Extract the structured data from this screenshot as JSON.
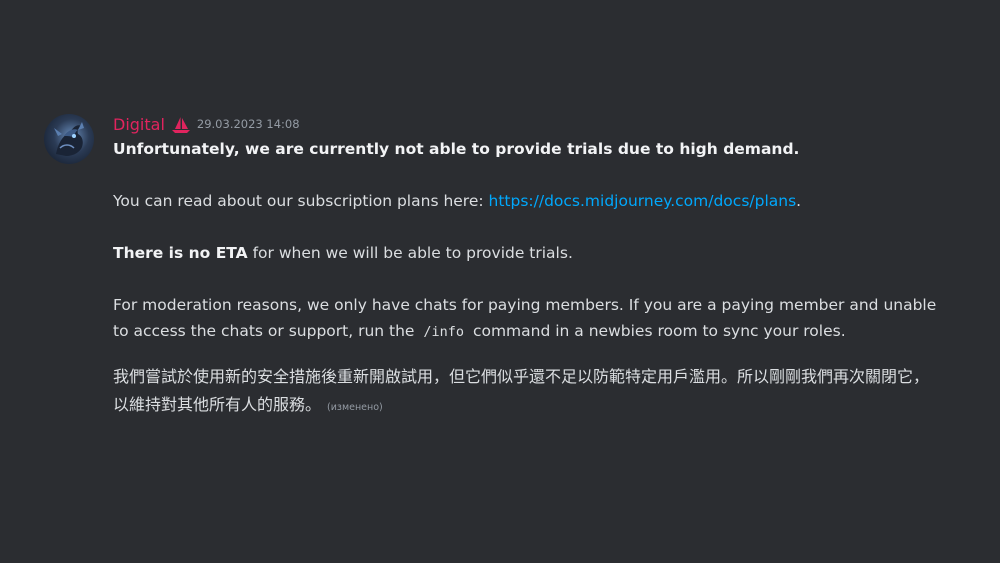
{
  "message": {
    "username": "Digital",
    "badge_icon": "ship-sail-icon",
    "timestamp": "29.03.2023 14:08",
    "line1": "Unfortunately, we are currently not able to provide trials due to high demand.",
    "line2_prefix": "You can read about our subscription plans here: ",
    "line2_link": "https://docs.midjourney.com/docs/plans",
    "line2_suffix": ".",
    "line3_bold": "There is no ETA",
    "line3_rest": " for when we will be able to provide trials.",
    "line4_part1": "For moderation reasons, we only have chats for paying members. If you are a paying member and unable to access the chats or support, run the ",
    "line4_code": "/info",
    "line4_part2": " command in a newbies room to sync your roles.",
    "line5": "我們嘗試於使用新的安全措施後重新開啟試用，但它們似乎還不足以防範特定用戶濫用。所以剛剛我們再次關閉它，以維持對其他所有人的服務。",
    "edited_label": "(изменено)"
  },
  "colors": {
    "background": "#2b2d31",
    "username": "#e0245e",
    "link": "#00a8fc",
    "text": "#dbdee1",
    "muted": "#949ba4"
  }
}
